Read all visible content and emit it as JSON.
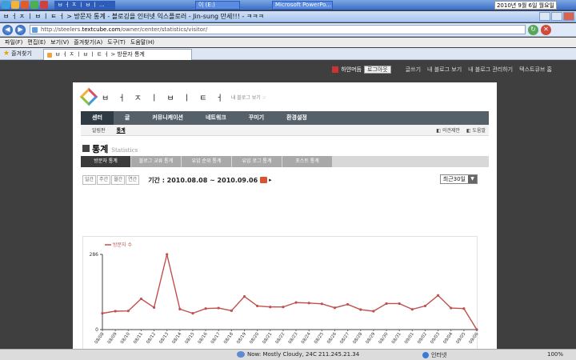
{
  "taskbar": {
    "tasks": [
      "ㅂ ㅓ ㅈ ㅣ ㅂ ㅣ ...",
      "이 (E:)",
      "Microsoft PowerPo..."
    ],
    "clock": "2010년 9월 6일 월요일"
  },
  "window": {
    "title": "ㅂ ㅓ ㅈ ㅣ ㅂ ㅣ ㅌ ㅓ > 방문자 통계 - 블로깅을 인터넷 익스플로러 - Jin-sung 만세!!! - ㅋㅋㅋ"
  },
  "address": {
    "prefix": "http://",
    "domain_pre": "steelers.",
    "domain": "textcube.com",
    "path": "/owner/center/statistics/visitor/"
  },
  "menu": [
    "파일(F)",
    "편집(E)",
    "보기(V)",
    "즐겨찾기(A)",
    "도구(T)",
    "도움말(H)"
  ],
  "favorites": {
    "label": "즐겨찾기",
    "tab": "ㅂ ㅓ ㅈ ㅣ ㅂ ㅣ ㅌ ㅓ > 방문자 통계"
  },
  "topnav": {
    "user": "하얀머듬",
    "logout": "로그아웃",
    "links": [
      "글쓰기",
      "내 블로그 보기",
      "내 블로그 관리하기",
      "텍스트큐브 홈"
    ]
  },
  "logo": {
    "text": "ㅂ ㅓ ㅈ ㅣ ㅂ ㅣ ㅌ ㅓ",
    "sub": "내 블로그 보기 ☞"
  },
  "mainnav": [
    "센터",
    "글",
    "커뮤니케이션",
    "네트워크",
    "꾸미기",
    "환경설정"
  ],
  "subnav": {
    "items": [
      "알림판",
      "통계"
    ],
    "right": [
      "◧ 의견제안",
      "◧ 도움말"
    ]
  },
  "heading": {
    "title": "통계",
    "sub": "Statistics"
  },
  "stat_tabs": [
    "방문자 통계",
    "블로그 교류 통계",
    "유입 순위 통계",
    "유입 로그 통계",
    "포스트 통계"
  ],
  "period": {
    "buttons": [
      "일간",
      "주간",
      "월간",
      "연간"
    ],
    "range_label": "기간 : 2010.08.08 ~ 2010.09.06",
    "select_value": "최근30일"
  },
  "chart_data": {
    "type": "line",
    "title": "",
    "xlabel": "",
    "ylabel": "",
    "ylim": [
      0,
      286
    ],
    "yticks": [
      0,
      286
    ],
    "legend": {
      "position": "top-left"
    },
    "grid": false,
    "categories": [
      "08/08",
      "08/09",
      "08/10",
      "08/11",
      "08/12",
      "08/13",
      "08/14",
      "08/15",
      "08/16",
      "08/17",
      "08/18",
      "08/19",
      "08/20",
      "08/21",
      "08/22",
      "08/23",
      "08/24",
      "08/25",
      "08/26",
      "08/27",
      "08/28",
      "08/29",
      "08/30",
      "08/31",
      "09/01",
      "09/02",
      "09/03",
      "09/04",
      "09/05",
      "09/06"
    ],
    "series": [
      {
        "name": "방문자 수",
        "color": "#c0504d",
        "values": [
          62,
          70,
          71,
          117,
          84,
          286,
          78,
          62,
          80,
          82,
          72,
          126,
          90,
          86,
          86,
          103,
          101,
          98,
          83,
          96,
          76,
          70,
          99,
          99,
          77,
          90,
          130,
          82,
          80,
          0
        ]
      }
    ]
  },
  "status": {
    "weather": "Now: Mostly Cloudy, 24C",
    "ip": "211.245.21.34",
    "zone": "인터넷",
    "zoom": "100%"
  }
}
